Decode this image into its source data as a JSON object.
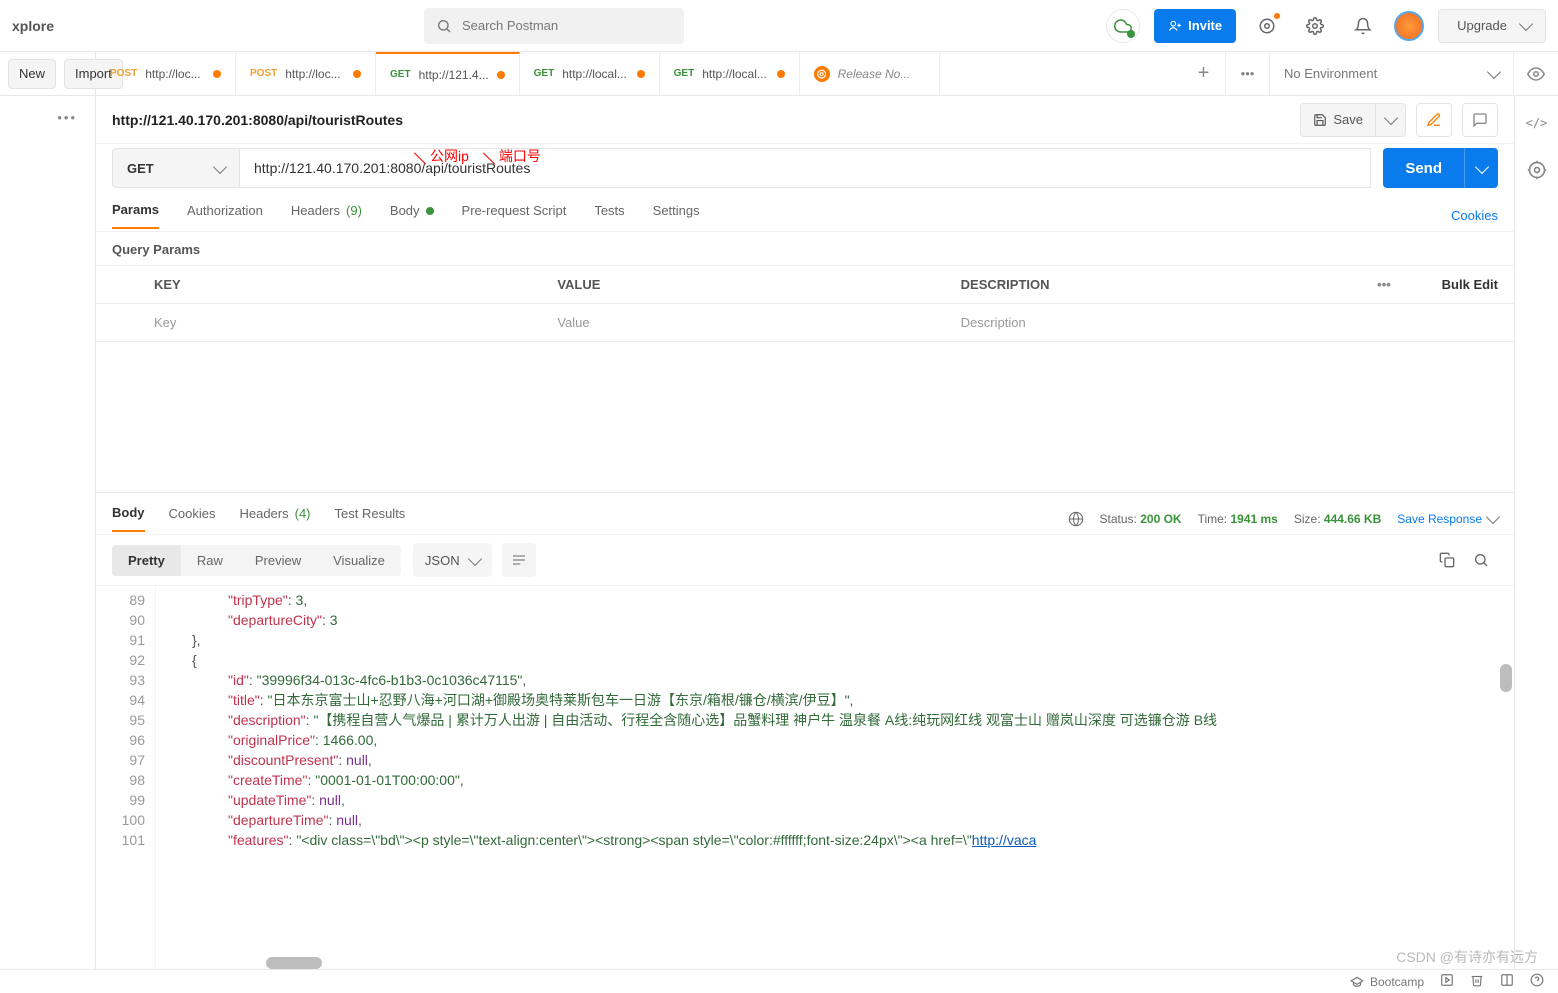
{
  "topbar": {
    "explore": "xplore",
    "search_placeholder": "Search Postman",
    "invite": "Invite",
    "upgrade": "Upgrade"
  },
  "row2": {
    "new": "New",
    "import": "Import",
    "tabs": [
      {
        "method": "POST",
        "methodClass": "m-post",
        "title": "http://loc...",
        "dot": true
      },
      {
        "method": "POST",
        "methodClass": "m-post",
        "title": "http://loc...",
        "dot": true
      },
      {
        "method": "GET",
        "methodClass": "m-get",
        "title": "http://121.4...",
        "dot": true,
        "active": true
      },
      {
        "method": "GET",
        "methodClass": "m-get",
        "title": "http://local...",
        "dot": true
      },
      {
        "method": "GET",
        "methodClass": "m-get",
        "title": "http://local...",
        "dot": true
      }
    ],
    "release_tab": "Release No...",
    "env": "No Environment"
  },
  "request": {
    "breadcrumb": "http://121.40.170.201:8080/api/touristRoutes",
    "save": "Save",
    "method": "GET",
    "url": "http://121.40.170.201:8080/api/touristRoutes",
    "send": "Send",
    "annotations": {
      "ip": "公网ip",
      "port": "端口号"
    },
    "tabs": {
      "params": "Params",
      "auth": "Authorization",
      "headers": "Headers",
      "headers_count": "(9)",
      "body": "Body",
      "prerequest": "Pre-request Script",
      "tests": "Tests",
      "settings": "Settings",
      "cookies": "Cookies"
    },
    "query_params_label": "Query Params",
    "table": {
      "key": "KEY",
      "value": "VALUE",
      "description": "DESCRIPTION",
      "bulk": "Bulk Edit",
      "ph_key": "Key",
      "ph_value": "Value",
      "ph_desc": "Description"
    }
  },
  "response": {
    "tabs": {
      "body": "Body",
      "cookies": "Cookies",
      "headers": "Headers",
      "headers_count": "(4)",
      "tests": "Test Results"
    },
    "status_label": "Status:",
    "status_val": "200 OK",
    "time_label": "Time:",
    "time_val": "1941 ms",
    "size_label": "Size:",
    "size_val": "444.66 KB",
    "save": "Save Response",
    "modes": {
      "pretty": "Pretty",
      "raw": "Raw",
      "preview": "Preview",
      "visualize": "Visualize"
    },
    "format": "JSON",
    "gutter_start": 89,
    "lines": [
      {
        "n": 89,
        "ind": 2,
        "html": "<span class='tok-key'>\"tripType\"</span><span class='tok-punc'>: </span><span class='tok-num'>3</span><span class='tok-punc'>,</span>"
      },
      {
        "n": 90,
        "ind": 2,
        "html": "<span class='tok-key'>\"departureCity\"</span><span class='tok-punc'>: </span><span class='tok-num'>3</span>"
      },
      {
        "n": 91,
        "ind": 1,
        "html": "<span class='tok-punc'>},</span>"
      },
      {
        "n": 92,
        "ind": 1,
        "html": "<span class='tok-punc'>{</span>"
      },
      {
        "n": 93,
        "ind": 2,
        "html": "<span class='tok-key'>\"id\"</span><span class='tok-punc'>: </span><span class='tok-str'>\"39996f34-013c-4fc6-b1b3-0c1036c47115\"</span><span class='tok-punc'>,</span>"
      },
      {
        "n": 94,
        "ind": 2,
        "html": "<span class='tok-key'>\"title\"</span><span class='tok-punc'>: </span><span class='tok-str'>\"日本东京富士山+忍野八海+河口湖+御殿场奥特莱斯包车一日游【东京/箱根/镰仓/横滨/伊豆】\"</span><span class='tok-punc'>,</span>"
      },
      {
        "n": 95,
        "ind": 2,
        "html": "<span class='tok-key'>\"description\"</span><span class='tok-punc'>: </span><span class='tok-str'>\"【携程自营人气爆品 | 累计万人出游 | 自由活动、行程全含随心选】品蟹料理 神户牛 温泉餐 A线:纯玩网红线 观富士山 赠岚山深度 可选镰仓游 B线</span>"
      },
      {
        "n": 96,
        "ind": 2,
        "html": "<span class='tok-key'>\"originalPrice\"</span><span class='tok-punc'>: </span><span class='tok-num'>1466.00</span><span class='tok-punc'>,</span>"
      },
      {
        "n": 97,
        "ind": 2,
        "html": "<span class='tok-key'>\"discountPresent\"</span><span class='tok-punc'>: </span><span class='tok-null'>null</span><span class='tok-punc'>,</span>"
      },
      {
        "n": 98,
        "ind": 2,
        "html": "<span class='tok-key'>\"createTime\"</span><span class='tok-punc'>: </span><span class='tok-str'>\"0001-01-01T00:00:00\"</span><span class='tok-punc'>,</span>"
      },
      {
        "n": 99,
        "ind": 2,
        "html": "<span class='tok-key'>\"updateTime\"</span><span class='tok-punc'>: </span><span class='tok-null'>null</span><span class='tok-punc'>,</span>"
      },
      {
        "n": 100,
        "ind": 2,
        "html": "<span class='tok-key'>\"departureTime\"</span><span class='tok-punc'>: </span><span class='tok-null'>null</span><span class='tok-punc'>,</span>"
      },
      {
        "n": 101,
        "ind": 2,
        "html": "<span class='tok-key'>\"features\"</span><span class='tok-punc'>: </span><span class='tok-str'>\"&lt;div class=\\\"bd\\\"&gt;&lt;p style=\\\"text-align:center\\\"&gt;&lt;strong&gt;&lt;span style=\\\"color:#ffffff;font-size:24px\\\"&gt;&lt;a href=\\\"</span><span class='tok-url'>http://vaca</span>"
      }
    ]
  },
  "footer": {
    "bootcamp": "Bootcamp"
  },
  "watermark": "CSDN @有诗亦有远方"
}
